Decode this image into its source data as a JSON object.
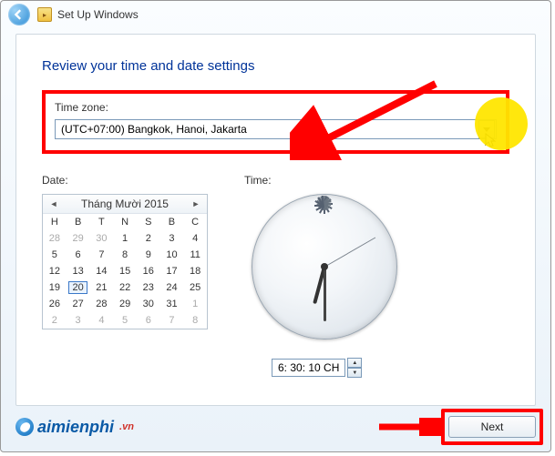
{
  "window": {
    "title": "Set Up Windows"
  },
  "heading": "Review your time and date settings",
  "timezone": {
    "label": "Time zone:",
    "selected": "(UTC+07:00) Bangkok, Hanoi, Jakarta"
  },
  "date": {
    "label": "Date:",
    "month_title": "Tháng Mười 2015",
    "dow": [
      "H",
      "B",
      "T",
      "N",
      "S",
      "B",
      "C"
    ],
    "grid": [
      [
        {
          "d": 28,
          "o": 1
        },
        {
          "d": 29,
          "o": 1
        },
        {
          "d": 30,
          "o": 1
        },
        {
          "d": 1
        },
        {
          "d": 2
        },
        {
          "d": 3
        },
        {
          "d": 4
        }
      ],
      [
        {
          "d": 5
        },
        {
          "d": 6
        },
        {
          "d": 7
        },
        {
          "d": 8
        },
        {
          "d": 9
        },
        {
          "d": 10
        },
        {
          "d": 11
        }
      ],
      [
        {
          "d": 12
        },
        {
          "d": 13
        },
        {
          "d": 14
        },
        {
          "d": 15
        },
        {
          "d": 16
        },
        {
          "d": 17
        },
        {
          "d": 18
        }
      ],
      [
        {
          "d": 19
        },
        {
          "d": 20,
          "sel": 1
        },
        {
          "d": 21
        },
        {
          "d": 22
        },
        {
          "d": 23
        },
        {
          "d": 24
        },
        {
          "d": 25
        }
      ],
      [
        {
          "d": 26
        },
        {
          "d": 27
        },
        {
          "d": 28
        },
        {
          "d": 29
        },
        {
          "d": 30
        },
        {
          "d": 31
        },
        {
          "d": 1,
          "o": 1
        }
      ],
      [
        {
          "d": 2,
          "o": 1
        },
        {
          "d": 3,
          "o": 1
        },
        {
          "d": 4,
          "o": 1
        },
        {
          "d": 5,
          "o": 1
        },
        {
          "d": 6,
          "o": 1
        },
        {
          "d": 7,
          "o": 1
        },
        {
          "d": 8,
          "o": 1
        }
      ]
    ]
  },
  "time": {
    "label": "Time:",
    "value": "6: 30: 10 CH"
  },
  "footer": {
    "brand": "aimienphi",
    "brand_suffix": ".vn",
    "next": "Next"
  },
  "annotation": {
    "highlight": "#ff0000",
    "accent": "#ffe600"
  }
}
